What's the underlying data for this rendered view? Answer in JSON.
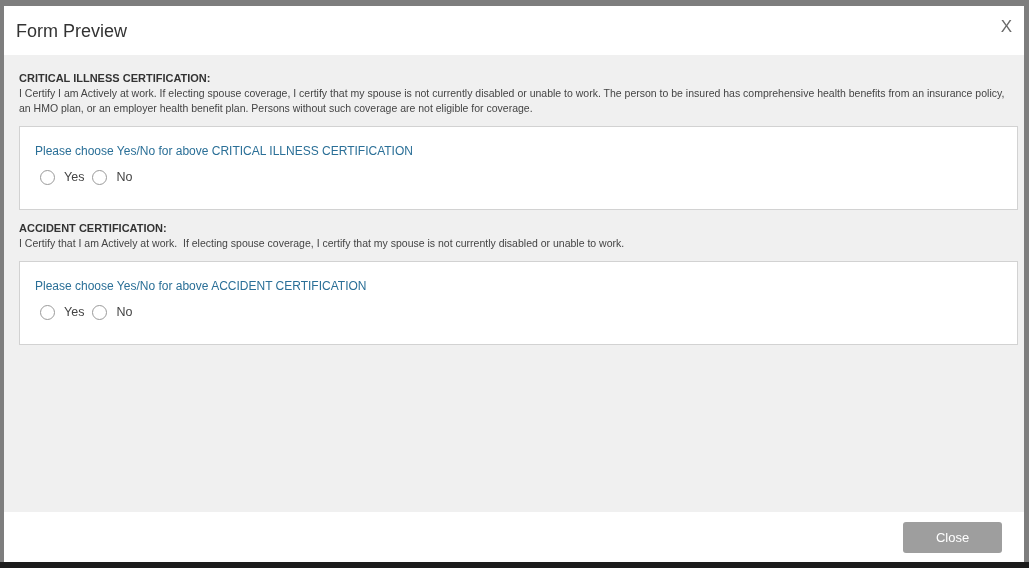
{
  "dialog": {
    "title": "Form Preview",
    "close_label": "X"
  },
  "sections": [
    {
      "heading": "CRITICAL ILLNESS CERTIFICATION:",
      "text": "I Certify I am Actively at work. If electing spouse coverage, I certify that my spouse is not currently disabled or unable to work. The person to be insured has comprehensive health benefits from an insurance policy, an HMO plan, or an employer health benefit plan. Persons without such coverage are not eligible for coverage.",
      "question": "Please choose Yes/No for above CRITICAL ILLNESS CERTIFICATION",
      "options": [
        {
          "label": "Yes",
          "selected": false
        },
        {
          "label": "No",
          "selected": false
        }
      ]
    },
    {
      "heading": "ACCIDENT CERTIFICATION:",
      "text": "I Certify that I am Actively at work.  If electing spouse coverage, I certify that my spouse is not currently disabled or unable to work.",
      "question": "Please choose Yes/No for above ACCIDENT CERTIFICATION",
      "options": [
        {
          "label": "Yes",
          "selected": false
        },
        {
          "label": "No",
          "selected": false
        }
      ]
    }
  ],
  "footer": {
    "buttons": [
      "Close"
    ]
  }
}
